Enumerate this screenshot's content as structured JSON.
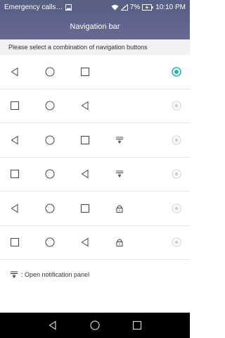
{
  "status_bar": {
    "left_text": "Emergency calls…",
    "battery_text": "7%",
    "time": "10:10 PM",
    "icons": [
      "image-icon",
      "wifi-icon",
      "signal-icon",
      "battery-charging-icon"
    ]
  },
  "header": {
    "title": "Navigation bar"
  },
  "subtitle": "Please select a combination of navigation buttons",
  "options": [
    {
      "keys": [
        "back",
        "home",
        "recent"
      ],
      "selected": true
    },
    {
      "keys": [
        "recent",
        "home",
        "back"
      ],
      "selected": false
    },
    {
      "keys": [
        "back",
        "home",
        "recent",
        "notification"
      ],
      "selected": false
    },
    {
      "keys": [
        "recent",
        "home",
        "back",
        "notification"
      ],
      "selected": false
    },
    {
      "keys": [
        "back",
        "home",
        "recent",
        "lock"
      ],
      "selected": false
    },
    {
      "keys": [
        "recent",
        "home",
        "back",
        "lock"
      ],
      "selected": false
    }
  ],
  "legend": {
    "icon": "notification-icon",
    "text": ": Open notification panel"
  },
  "navbar": {
    "buttons": [
      "back",
      "home",
      "recent"
    ]
  },
  "colors": {
    "accent": "#26b5ad",
    "header": "#5d6189",
    "navbar": "#000000"
  }
}
